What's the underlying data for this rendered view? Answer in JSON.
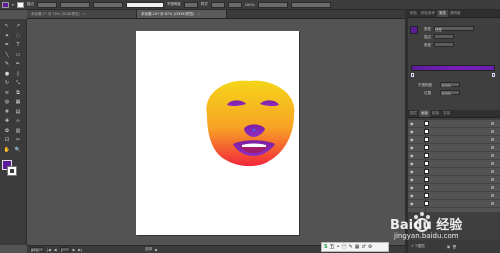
{
  "control_bar": {
    "stroke_weight_label": "描边",
    "opacity_label": "不透明度",
    "opacity_value": "100%",
    "style_label": "样式",
    "items_text": "文档设置    首选项",
    "extra_text": "不透明度",
    "colors": {
      "fill": "#5b1b9a",
      "stroke": "#ffffff"
    }
  },
  "tabs": [
    {
      "label": "未标题-1* @ 78% (RGB/预览)"
    },
    {
      "label": "未标题-10* @ 87% (CMYK/预览)"
    }
  ],
  "tools": [
    "selection-tool",
    "direct-selection-tool",
    "magic-wand-tool",
    "lasso-tool",
    "pen-tool",
    "type-tool",
    "line-tool",
    "rectangle-tool",
    "paintbrush-tool",
    "pencil-tool",
    "blob-brush-tool",
    "eraser-tool",
    "rotate-tool",
    "scale-tool",
    "width-tool",
    "free-transform-tool",
    "shape-builder-tool",
    "perspective-grid-tool",
    "mesh-tool",
    "gradient-tool",
    "eyedropper-tool",
    "blend-tool",
    "symbol-sprayer-tool",
    "column-graph-tool",
    "artboard-tool",
    "slice-tool",
    "hand-tool",
    "zoom-tool"
  ],
  "tool_glyphs": [
    "↖",
    "↗",
    "✦",
    "◌",
    "✒",
    "T",
    "╲",
    "▭",
    "✎",
    "✏",
    "●",
    "◊",
    "↻",
    "⤡",
    "≋",
    "⧉",
    "◍",
    "▦",
    "#",
    "▤",
    "✚",
    "∞",
    "✿",
    "▥",
    "⊡",
    "✂",
    "✋",
    "🔍"
  ],
  "status_bar": {
    "zoom": "87%",
    "page": "1",
    "mode": "选择"
  },
  "right_panel": {
    "tabs": [
      "颜色",
      "颜色参考",
      "渐变",
      "透明度"
    ],
    "gradient": {
      "type_label": "类型",
      "type_value": "线性",
      "stroke_label": "描边",
      "angle_label": "角度",
      "opacity_label": "不透明度",
      "opacity_value": "100%",
      "position_label": "位置",
      "position_value": "100%"
    },
    "layer_tabs": [
      "图层",
      "画板",
      "链接",
      "变量"
    ],
    "layers": [
      {
        "name": "layer-1"
      },
      {
        "name": "layer-2"
      },
      {
        "name": "layer-3"
      },
      {
        "name": "layer-4"
      },
      {
        "name": "layer-5"
      },
      {
        "name": "layer-6"
      },
      {
        "name": "layer-7"
      },
      {
        "name": "layer-8"
      },
      {
        "name": "layer-9"
      },
      {
        "name": "layer-10"
      },
      {
        "name": "layer-11"
      }
    ],
    "layers_footer": "1 个图层",
    "colors": {
      "gradient_start": "#5b1c9b",
      "gradient_end": "#7a1fbb"
    }
  },
  "watermark": {
    "brand": "Baidu 经验",
    "url": "jingyan.baidu.com"
  },
  "ime_bar": {
    "items": [
      "S",
      "五",
      "•",
      "㊀",
      "✎",
      "▦",
      "♂",
      "⚙"
    ]
  },
  "artwork": {
    "colors": {
      "face_top": "#f5d519",
      "face_bottom": "#f2263a",
      "feature": "#7b1fa2"
    }
  }
}
